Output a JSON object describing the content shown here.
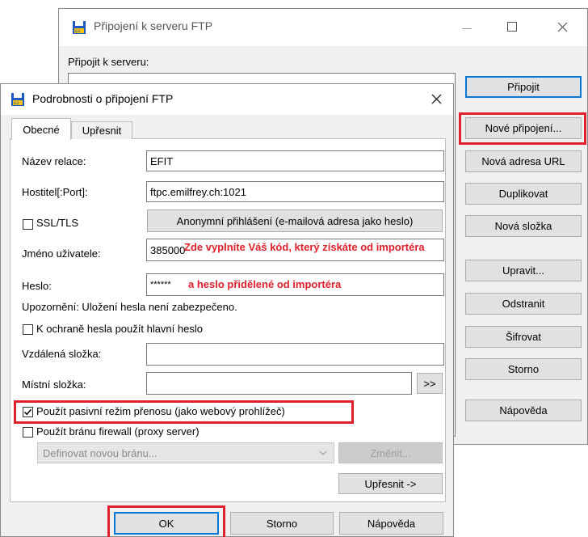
{
  "main_window": {
    "title": "Připojení k serveru FTP",
    "connect_to_label": "Připojit k serveru:",
    "buttons": {
      "connect": "Připojit",
      "new_connection": "Nové připojení...",
      "new_url": "Nová adresa URL",
      "duplicate": "Duplikovat",
      "new_folder": "Nová složka",
      "edit": "Upravit...",
      "delete": "Odstranit",
      "encrypt": "Šifrovat",
      "cancel": "Storno",
      "help": "Nápověda"
    }
  },
  "dialog": {
    "title": "Podrobnosti o připojení FTP",
    "tabs": [
      "Obecné",
      "Upřesnit"
    ],
    "session_name_label": "Název relace:",
    "session_name_value": "EFIT",
    "host_label": "Hostitel[:Port]:",
    "host_value": "ftpc.emilfrey.ch:1021",
    "ssl_label": "SSL/TLS",
    "anonymous_button": "Anonymní přihlášení (e-mailová adresa jako heslo)",
    "username_label": "Jméno uživatele:",
    "username_value": "385000",
    "password_label": "Heslo:",
    "password_value": "******",
    "warning": "Upozornění: Uložení hesla není zabezpečeno.",
    "master_password_label": "K ochraně hesla použít hlavní heslo",
    "remote_folder_label": "Vzdálená složka:",
    "remote_folder_value": "",
    "local_folder_label": "Místní složka:",
    "local_folder_value": "",
    "browse_button": ">>",
    "passive_mode_label": "Použít pasivní režim přenosu (jako webový prohlížeč)",
    "firewall_label": "Použít bránu firewall (proxy server)",
    "gateway_select_value": "Definovat novou bránu...",
    "change_button": "Změnit...",
    "advanced_button": "Upřesnit ->",
    "ok_button": "OK",
    "cancel_button": "Storno",
    "help_button": "Nápověda"
  },
  "annotations": {
    "username_note": "Zde vyplníte Váš kód, který získáte od importéra",
    "password_note": "a heslo přidělené od importéra"
  },
  "colors": {
    "highlight_red": "#e0202c",
    "focus_blue": "#0078d7",
    "window_bg": "#f0f0f0"
  }
}
